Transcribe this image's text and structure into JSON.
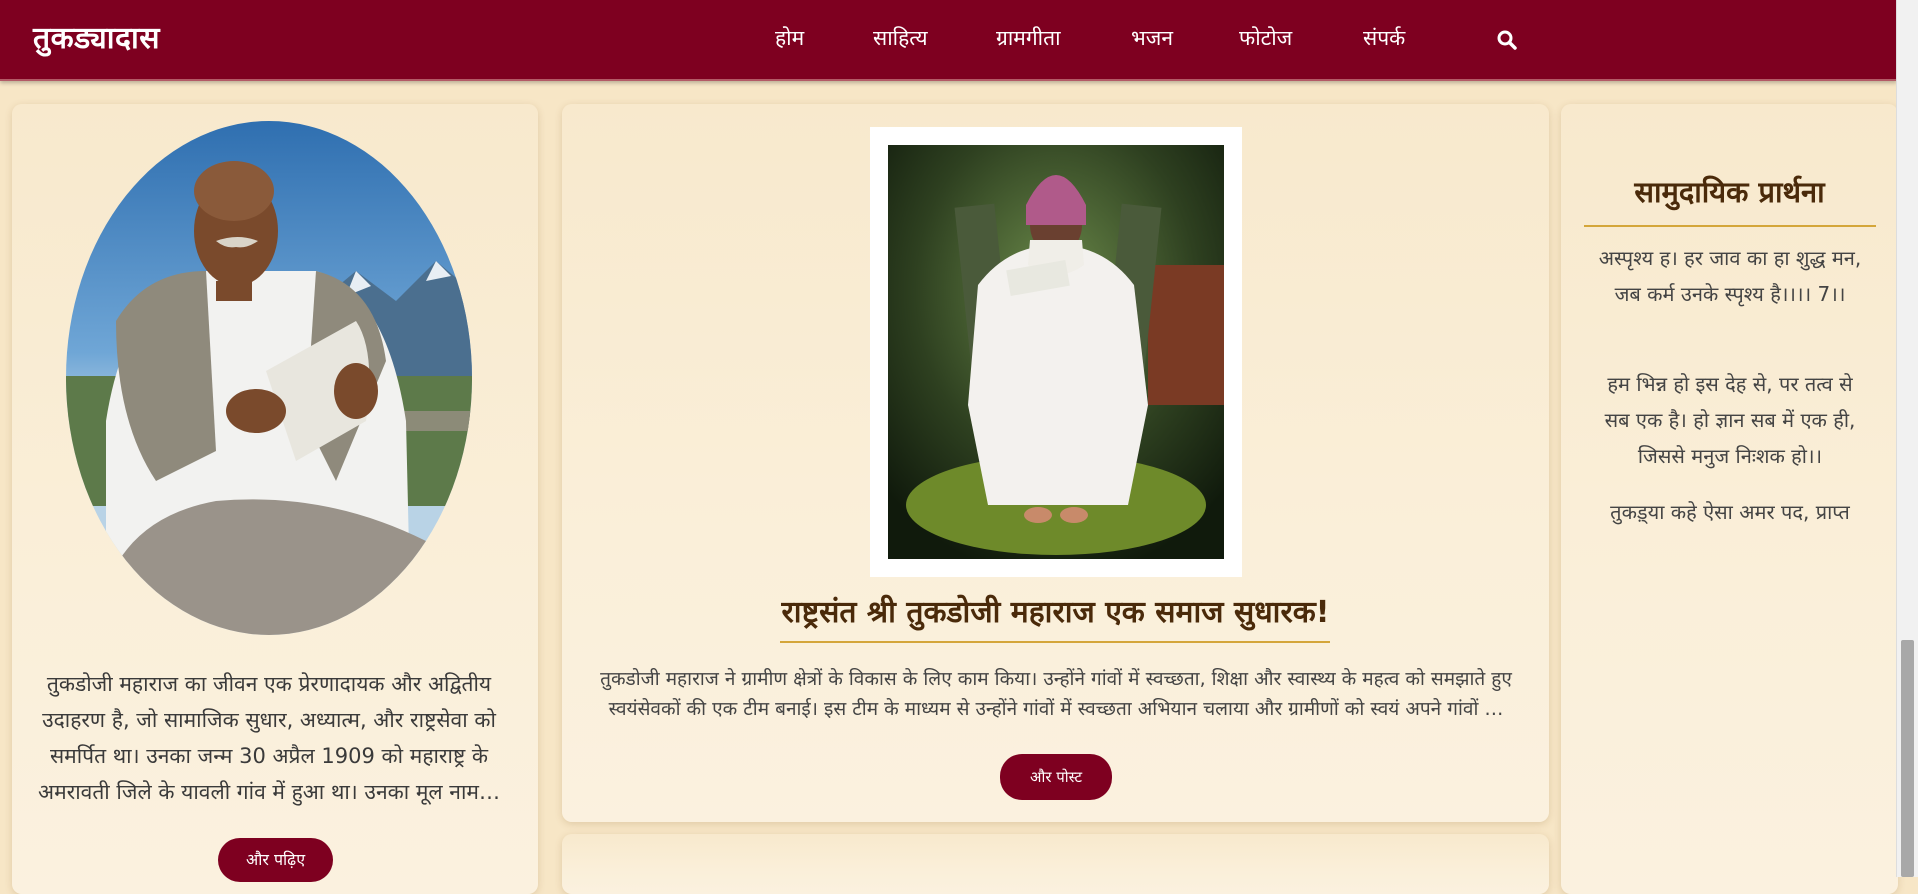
{
  "header": {
    "brand": "तुकड्यादास",
    "nav": [
      "होम",
      "साहित्य",
      "ग्रामगीता",
      "भजन",
      "फोटोज",
      "संपर्क"
    ],
    "search_icon": "search-icon"
  },
  "left_card": {
    "text": "तुकडोजी महाराज का जीवन एक प्रेरणादायक और अद्वितीय उदाहरण है, जो सामाजिक सुधार, अध्यात्म, और राष्ट्रसेवा को समर्पित था। उनका जन्म 30 अप्रैल 1909 को महाराष्ट्र के अमरावती जिले के यावली गांव में हुआ था। उनका मूल नाम…",
    "button": "और पढ़िए"
  },
  "middle_card": {
    "title": "राष्ट्रसंत श्री तुकडोजी महाराज एक समाज सुधारक!",
    "text": "तुकडोजी महाराज ने ग्रामीण क्षेत्रों के विकास के लिए काम किया। उन्होंने गांवों में स्वच्छता, शिक्षा और स्वास्थ्य के महत्व को समझाते हुए स्वयंसेवकों की एक टीम बनाई। इस टीम के माध्यम से उन्होंने गांवों में स्वच्छता अभियान चलाया और ग्रामीणों को स्वयं अपने गांवों …",
    "button": "और पोस्ट"
  },
  "right_card": {
    "title": "सामुदायिक प्रार्थना",
    "verses": [
      "अस्पृश्य ह। हर जाव का हा शुद्ध मन, जब कर्म उनके स्पृश्य है।।।। 7।।",
      "हम भिन्न हो इस देह से, पर तत्व से सब एक है। हो ज्ञान सब में एक ही, जिससे मनुज निःशक हो।।",
      "तुकड़्या कहे ऐसा अमर पद, प्राप्त"
    ]
  },
  "colors": {
    "header_bg": "#7e0020",
    "button_bg": "#7e0020",
    "accent_rule": "#d4a63a",
    "page_bg": "#f7e6c6"
  }
}
